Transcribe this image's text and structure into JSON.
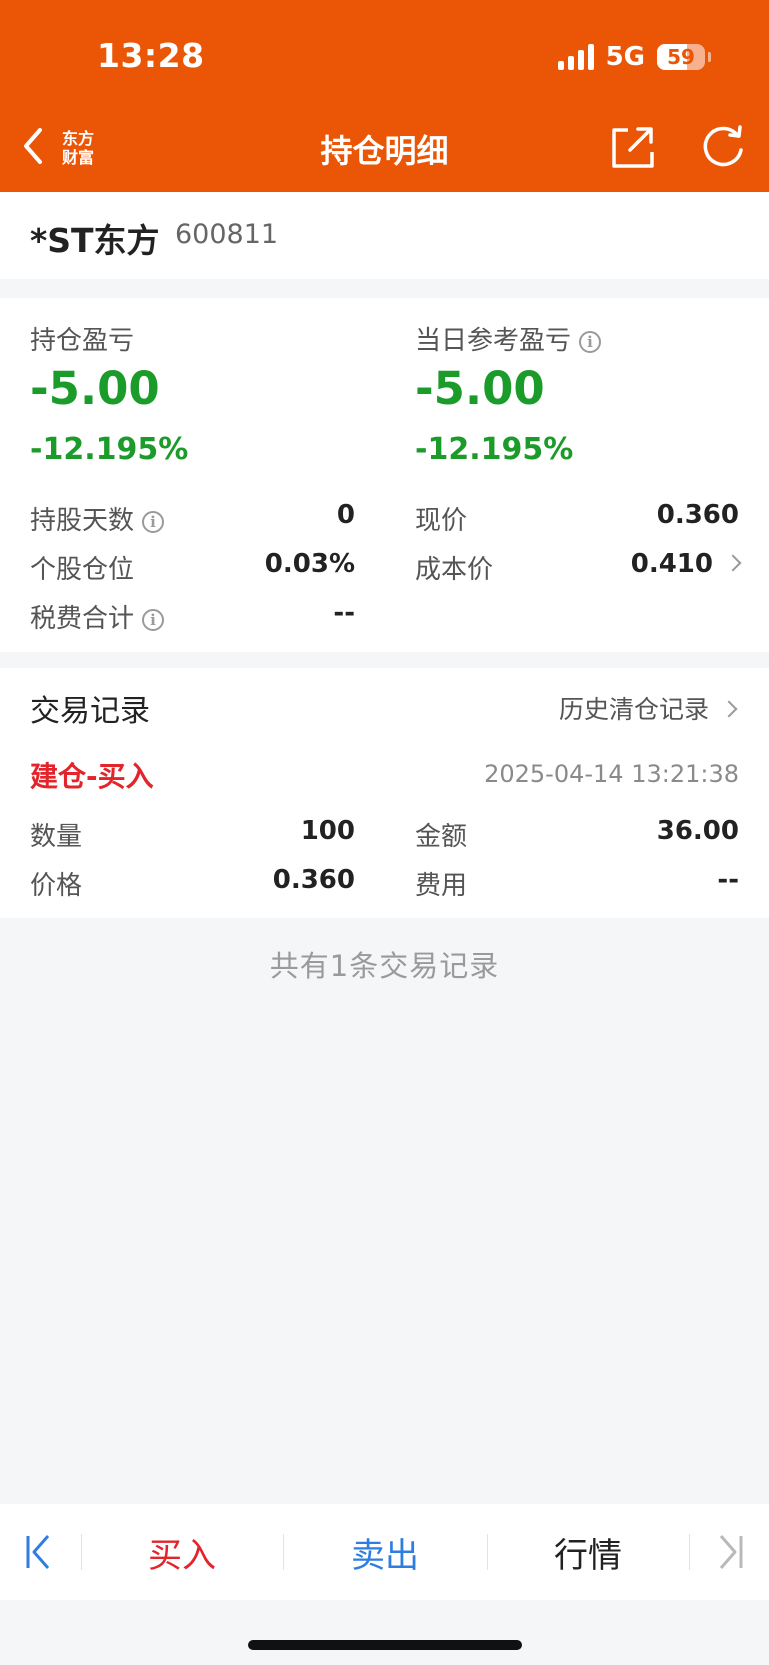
{
  "status_bar": {
    "time": "13:28",
    "network": "5G",
    "battery": "59"
  },
  "header": {
    "title": "持仓明细",
    "logo_line1": "东方",
    "logo_line2": "财富"
  },
  "stock": {
    "name": "*ST东方",
    "code": "600811"
  },
  "profit": {
    "holding_label": "持仓盈亏",
    "holding_value": "-5.00",
    "holding_pct": "-12.195%",
    "daily_label": "当日参考盈亏",
    "daily_value": "-5.00",
    "daily_pct": "-12.195%"
  },
  "details": {
    "days_label": "持股天数",
    "days_value": "0",
    "position_label": "个股仓位",
    "position_value": "0.03%",
    "tax_label": "税费合计",
    "tax_value": "--",
    "price_label": "现价",
    "price_value": "0.360",
    "cost_label": "成本价",
    "cost_value": "0.410"
  },
  "trades": {
    "title": "交易记录",
    "history_link": "历史清仓记录",
    "items": [
      {
        "type": "建仓-买入",
        "time": "2025-04-14 13:21:38",
        "qty_label": "数量",
        "qty": "100",
        "amount_label": "金额",
        "amount": "36.00",
        "price_label": "价格",
        "price": "0.360",
        "fee_label": "费用",
        "fee": "--"
      }
    ],
    "summary": "共有1条交易记录"
  },
  "bottom_bar": {
    "buy": "买入",
    "sell": "卖出",
    "market": "行情"
  },
  "colors": {
    "header": "#ea5506",
    "loss": "#1a9b2a",
    "buy": "#e3242b",
    "sell": "#2f7de1"
  }
}
